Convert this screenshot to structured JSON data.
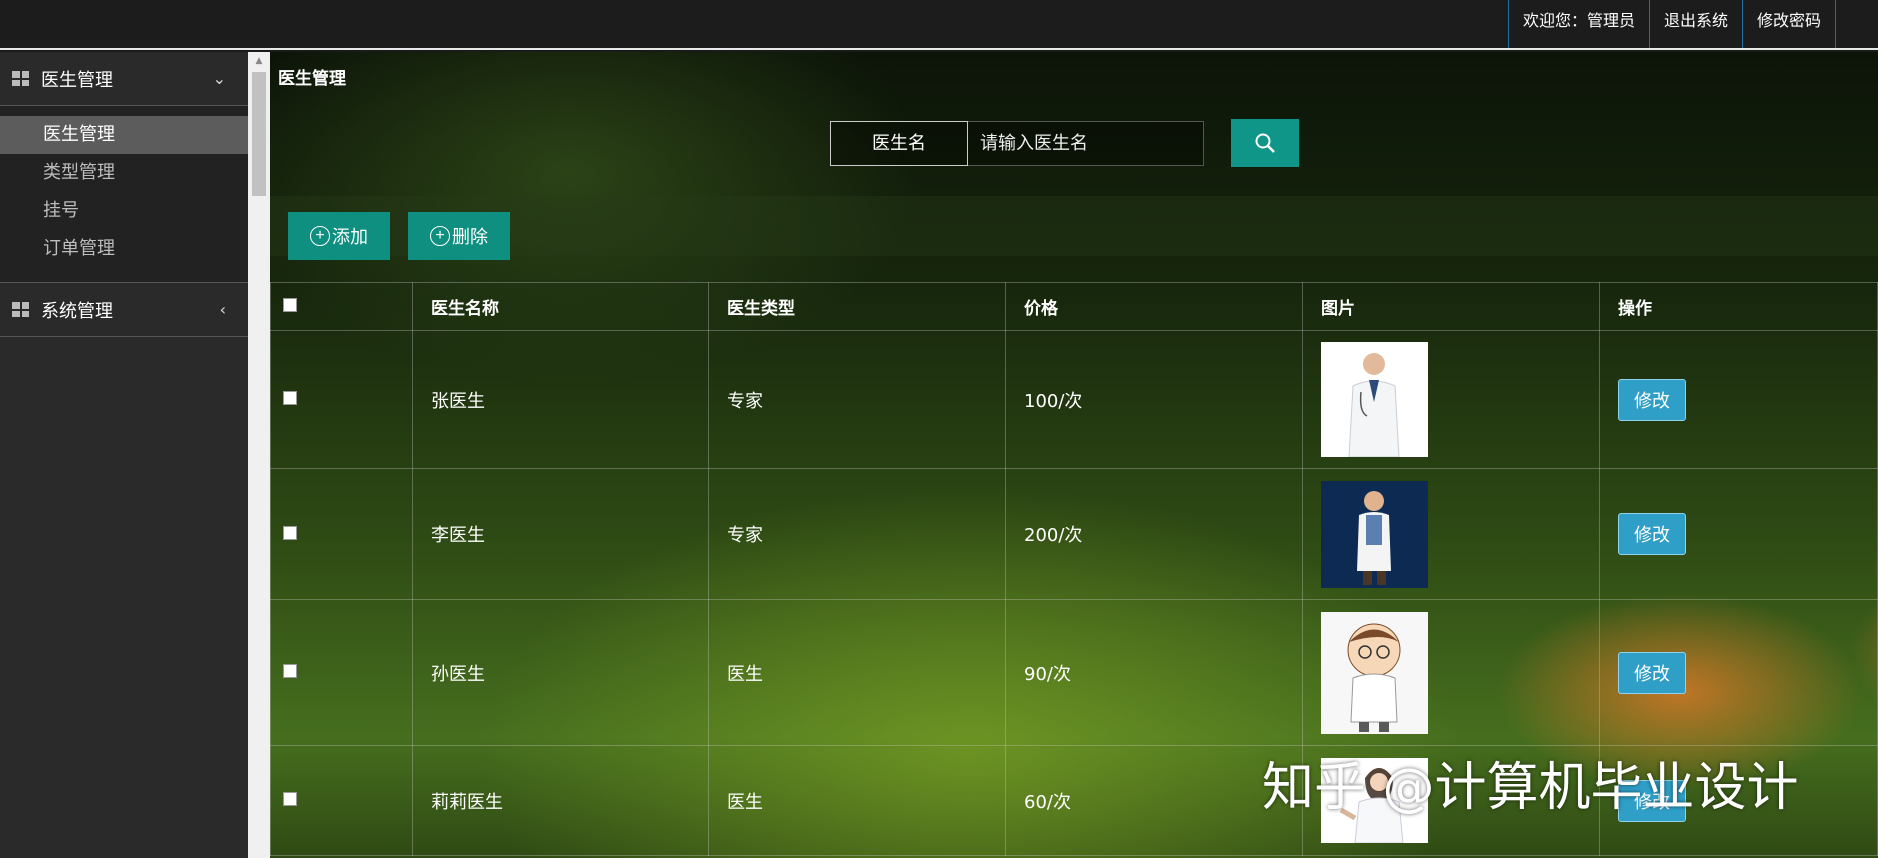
{
  "header": {
    "welcome": "欢迎您：管理员",
    "logout": "退出系统",
    "change_password": "修改密码"
  },
  "sidebar": {
    "groups": [
      {
        "label": "医生管理",
        "items": [
          "医生管理",
          "类型管理",
          "挂号",
          "订单管理"
        ],
        "active_item": "医生管理"
      },
      {
        "label": "系统管理"
      }
    ]
  },
  "main": {
    "title": "医生管理",
    "search": {
      "label": "医生名",
      "placeholder": "请输入医生名"
    },
    "toolbar": {
      "add_label": "添加",
      "delete_label": "删除"
    },
    "table": {
      "columns": [
        "医生名称",
        "医生类型",
        "价格",
        "图片",
        "操作"
      ],
      "rows": [
        {
          "name": "张医生",
          "type": "专家",
          "price": "100/次",
          "action": "修改"
        },
        {
          "name": "李医生",
          "type": "专家",
          "price": "200/次",
          "action": "修改"
        },
        {
          "name": "孙医生",
          "type": "医生",
          "price": "90/次",
          "action": "修改"
        },
        {
          "name": "莉莉医生",
          "type": "医生",
          "price": "60/次",
          "action": "修改"
        }
      ]
    }
  },
  "watermark": "知乎 @计算机毕业设计",
  "colors": {
    "accent": "#109688",
    "edit_button": "#2f9fc8",
    "topbar_divider": "#1f6fa3"
  }
}
